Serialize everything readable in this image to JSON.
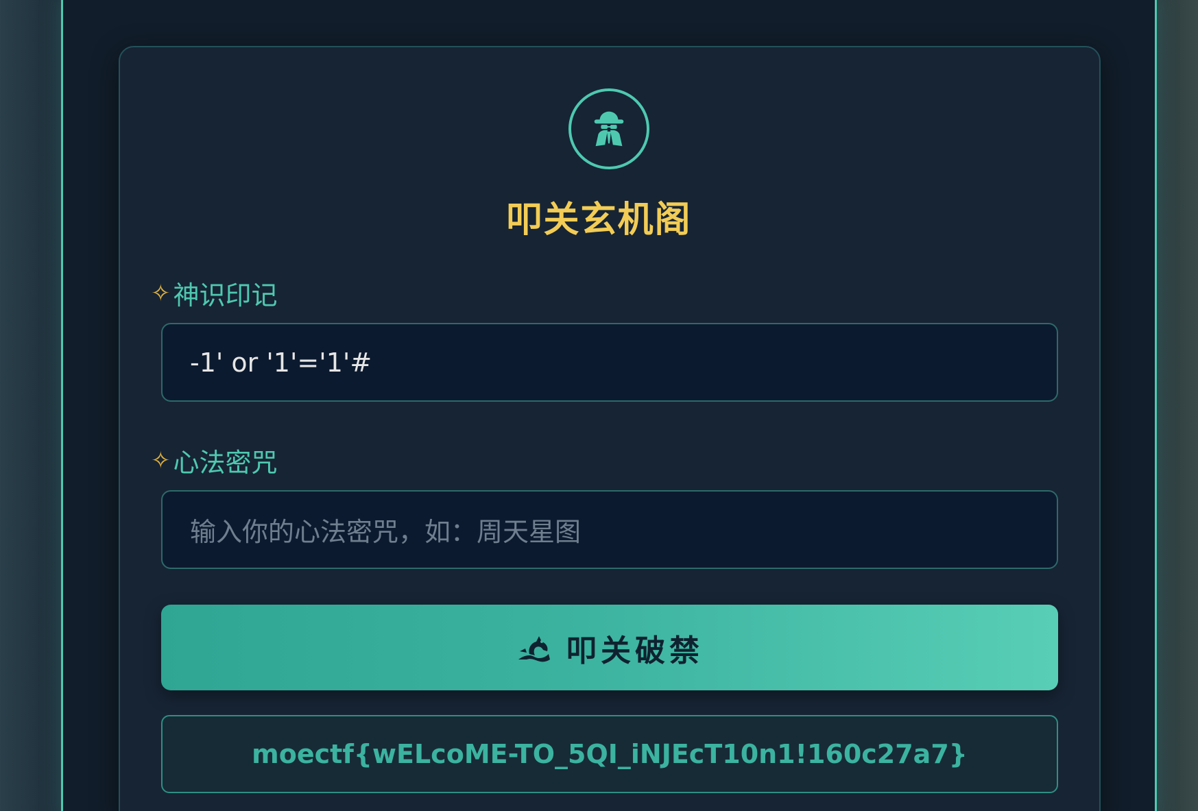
{
  "page": {
    "title": "叩关玄机阁",
    "avatar_icon": "spy-icon"
  },
  "form": {
    "field1": {
      "label": "神识印记",
      "value": "-1' or '1'='1'#"
    },
    "field2": {
      "label": "心法密咒",
      "placeholder": "输入你的心法密咒，如：周天星图"
    },
    "submit": {
      "label": "叩关破禁",
      "icon": "dragon-icon"
    }
  },
  "result": {
    "text": "moectf{wELcoME-TO_5QI_iNJEcT10n1!160c27a7}"
  },
  "colors": {
    "accent": "#4ec9b0",
    "title": "#f2cc55",
    "sparkle": "#e3b33e"
  }
}
